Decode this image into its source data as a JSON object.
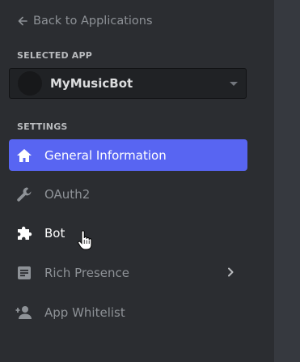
{
  "back_link": {
    "label": "Back to Applications",
    "icon": "arrow-left-icon"
  },
  "selected_app": {
    "section_label": "SELECTED APP",
    "name": "MyMusicBot"
  },
  "settings": {
    "section_label": "SETTINGS",
    "items": [
      {
        "label": "General Information",
        "icon": "home-icon",
        "state": "active"
      },
      {
        "label": "OAuth2",
        "icon": "wrench-icon",
        "state": "default"
      },
      {
        "label": "Bot",
        "icon": "puzzle-icon",
        "state": "hover"
      },
      {
        "label": "Rich Presence",
        "icon": "document-icon",
        "state": "default",
        "has_submenu": true
      },
      {
        "label": "App Whitelist",
        "icon": "person-add-icon",
        "state": "default"
      }
    ]
  },
  "colors": {
    "accent": "#5865f2",
    "sidebar_bg": "#2b2d31",
    "main_bg": "#36393f",
    "muted_text": "#8e9297"
  }
}
